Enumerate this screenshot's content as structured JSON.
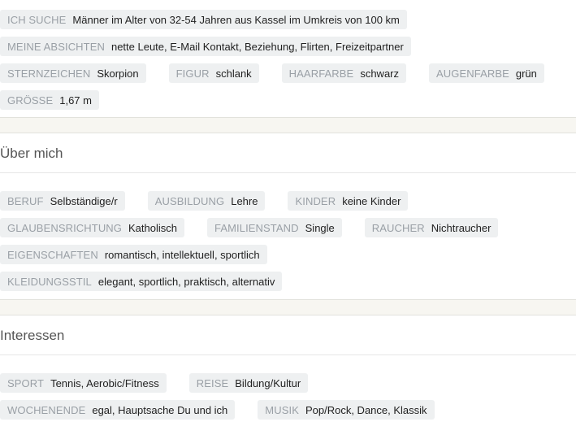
{
  "basics": [
    [
      {
        "label": "ICH SUCHE",
        "value": "Männer im Alter von 32-54 Jahren aus Kassel im Umkreis von 100 km"
      }
    ],
    [
      {
        "label": "MEINE ABSICHTEN",
        "value": "nette Leute, E-Mail Kontakt, Beziehung, Flirten, Freizeitpartner"
      }
    ],
    [
      {
        "label": "STERNZEICHEN",
        "value": "Skorpion"
      },
      {
        "label": "FIGUR",
        "value": "schlank"
      },
      {
        "label": "HAARFARBE",
        "value": "schwarz"
      },
      {
        "label": "AUGENFARBE",
        "value": "grün"
      }
    ],
    [
      {
        "label": "GRÖSSE",
        "value": "1,67 m"
      }
    ]
  ],
  "about": {
    "title": "Über mich",
    "rows": [
      [
        {
          "label": "BERUF",
          "value": "Selbständige/r"
        },
        {
          "label": "AUSBILDUNG",
          "value": "Lehre"
        },
        {
          "label": "KINDER",
          "value": "keine Kinder"
        }
      ],
      [
        {
          "label": "GLAUBENSRICHTUNG",
          "value": "Katholisch"
        },
        {
          "label": "FAMILIENSTAND",
          "value": "Single"
        },
        {
          "label": "RAUCHER",
          "value": "Nichtraucher"
        }
      ],
      [
        {
          "label": "EIGENSCHAFTEN",
          "value": "romantisch, intellektuell, sportlich"
        }
      ],
      [
        {
          "label": "KLEIDUNGSSTIL",
          "value": "elegant, sportlich, praktisch, alternativ"
        }
      ]
    ]
  },
  "interests": {
    "title": "Interessen",
    "rows": [
      [
        {
          "label": "SPORT",
          "value": "Tennis, Aerobic/Fitness"
        },
        {
          "label": "REISE",
          "value": "Bildung/Kultur"
        }
      ],
      [
        {
          "label": "WOCHENENDE",
          "value": "egal, Hauptsache Du und ich"
        },
        {
          "label": "MUSIK",
          "value": "Pop/Rock, Dance, Klassik"
        }
      ]
    ]
  }
}
